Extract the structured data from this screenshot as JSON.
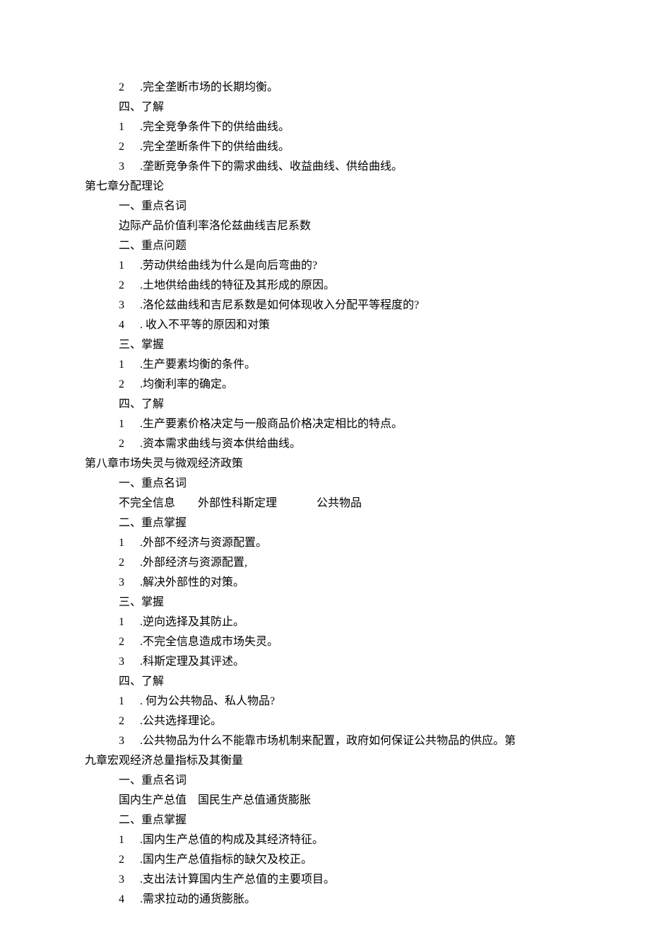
{
  "lines": [
    {
      "cls": "indent-2",
      "num": "2",
      "text": ".完全垄断市场的长期均衡。"
    },
    {
      "cls": "indent-2",
      "plain": "四、了解"
    },
    {
      "cls": "indent-2",
      "num": "1",
      "text": ".完全竞争条件下的供给曲线。"
    },
    {
      "cls": "indent-2",
      "num": "2",
      "text": ".完全垄断条件下的供给曲线。"
    },
    {
      "cls": "indent-2",
      "num": "3",
      "text": ".垄断竞争条件下的需求曲线、收益曲线、供给曲线。"
    },
    {
      "cls": "indent-1",
      "plain": "第七章分配理论"
    },
    {
      "cls": "indent-2",
      "plain": "一、重点名词"
    },
    {
      "cls": "indent-2",
      "plain": "边际产品价值利率洛伦兹曲线吉尼系数"
    },
    {
      "cls": "indent-2",
      "plain": "二、重点问题"
    },
    {
      "cls": "indent-2",
      "num": "1",
      "text": ".劳动供给曲线为什么是向后弯曲的?"
    },
    {
      "cls": "indent-2",
      "num": "2",
      "text": ".土地供给曲线的特征及其形成的原因。"
    },
    {
      "cls": "indent-2",
      "num": "3",
      "text": ".洛伦兹曲线和吉尼系数是如何体现收入分配平等程度的?"
    },
    {
      "cls": "indent-2",
      "num": "4",
      "text": ". 收入不平等的原因和对策"
    },
    {
      "cls": "indent-2",
      "plain": "三、掌握"
    },
    {
      "cls": "indent-2",
      "num": "1",
      "text": ".生产要素均衡的条件。"
    },
    {
      "cls": "indent-2",
      "num": "2",
      "text": ".均衡利率的确定。"
    },
    {
      "cls": "indent-2",
      "plain": "四、了解"
    },
    {
      "cls": "indent-2",
      "num": "1",
      "text": ".生产要素价格决定与一般商品价格决定相比的特点。"
    },
    {
      "cls": "indent-2",
      "num": "2",
      "text": ".资本需求曲线与资本供给曲线。"
    },
    {
      "cls": "indent-1",
      "plain": "第八章市场失灵与微观经济政策"
    },
    {
      "cls": "indent-2",
      "plain": "一、重点名词"
    },
    {
      "cls": "indent-2",
      "plain": "不完全信息        外部性科斯定理              公共物品"
    },
    {
      "cls": "indent-2",
      "plain": "二、重点掌握"
    },
    {
      "cls": "indent-2",
      "num": "1",
      "text": ".外部不经济与资源配置。"
    },
    {
      "cls": "indent-2",
      "num": "2",
      "text": ".外部经济与资源配置,"
    },
    {
      "cls": "indent-2",
      "num": "3",
      "text": ".解决外部性的对策。"
    },
    {
      "cls": "indent-2",
      "plain": "三、掌握"
    },
    {
      "cls": "indent-2",
      "num": "1",
      "text": ".逆向选择及其防止。"
    },
    {
      "cls": "indent-2",
      "num": "2",
      "text": ".不完全信息造成市场失灵。"
    },
    {
      "cls": "indent-2",
      "num": "3",
      "text": ".科斯定理及其评述。"
    },
    {
      "cls": "indent-2",
      "plain": "四、了解"
    },
    {
      "cls": "indent-2",
      "num": "1",
      "text": ". 何为公共物品、私人物品?"
    },
    {
      "cls": "indent-2",
      "num": "2",
      "text": ".公共选择理论。"
    },
    {
      "cls": "indent-2",
      "num": "3",
      "text": ".公共物品为什么不能靠市场机制来配置，政府如何保证公共物品的供应。第"
    },
    {
      "cls": "indent-1",
      "plain": "九章宏观经济总量指标及其衡量"
    },
    {
      "cls": "indent-2",
      "plain": "一、重点名词"
    },
    {
      "cls": "indent-2",
      "plain": "国内生产总值    国民生产总值通货膨胀"
    },
    {
      "cls": "indent-2",
      "plain": "二、重点掌握"
    },
    {
      "cls": "indent-2",
      "num": "1",
      "text": ".国内生产总值的构成及其经济特征。"
    },
    {
      "cls": "indent-2",
      "num": "2",
      "text": ".国内生产总值指标的缺欠及校正。"
    },
    {
      "cls": "indent-2",
      "num": "3",
      "text": ".支出法计算国内生产总值的主要项目。"
    },
    {
      "cls": "indent-2",
      "num": "4",
      "text": ".需求拉动的通货膨胀。"
    }
  ]
}
